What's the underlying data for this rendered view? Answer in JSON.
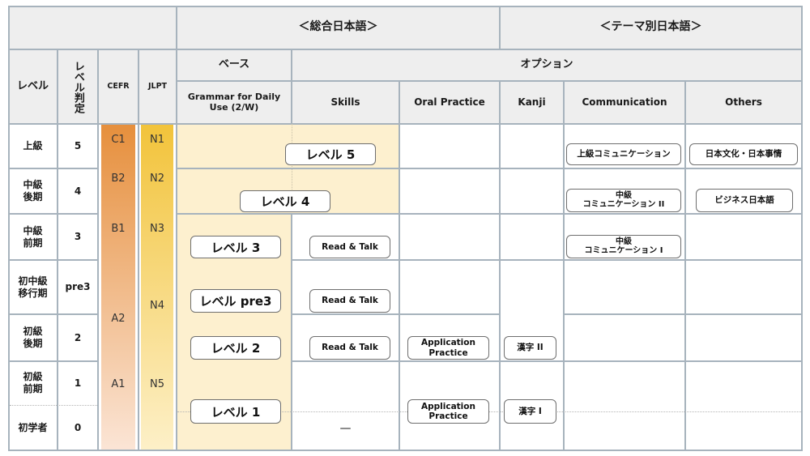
{
  "header": {
    "group_general": "＜総合日本語＞",
    "group_theme": "＜テーマ別日本語＞",
    "col_level": "レベル",
    "col_level_judge": "レベル判定",
    "col_cefr": "CEFR",
    "col_jlpt": "JLPT",
    "base": "ベース",
    "option": "オプション",
    "col_grammar": "Grammar for Daily Use (2/W)",
    "col_skills": "Skills",
    "col_oral": "Oral Practice",
    "col_kanji": "Kanji",
    "col_communication": "Communication",
    "col_others": "Others"
  },
  "rows": [
    {
      "level": "上級",
      "judge": "5"
    },
    {
      "level": "中級\n後期",
      "judge": "4"
    },
    {
      "level": "中級\n前期",
      "judge": "3"
    },
    {
      "level": "初中級\n移行期",
      "judge": "pre3"
    },
    {
      "level": "初級\n後期",
      "judge": "2"
    },
    {
      "level": "初級\n前期",
      "judge": "1"
    },
    {
      "level": "初学者",
      "judge": "0"
    }
  ],
  "cefr": [
    "C1",
    "B2",
    "B1",
    "A2",
    "A1"
  ],
  "jlpt": [
    "N1",
    "N2",
    "N3",
    "N4",
    "N5"
  ],
  "colors": {
    "cefr_top": "#e68f3c",
    "cefr_bottom": "#fbe5d6",
    "jlpt_top": "#f2c33a",
    "jlpt_bottom": "#fdf0c8",
    "base_bg": "#fdf0cf",
    "header_bg": "#eeeeee",
    "grid": "#a7b3bd"
  },
  "courses": {
    "grammar": [
      "レベル 5",
      "レベル 4",
      "レベル 3",
      "レベル pre3",
      "レベル 2",
      "レベル 1"
    ],
    "skills": [
      "Read & Talk",
      "Read & Talk",
      "Read & Talk"
    ],
    "skills_none": "—",
    "oral": [
      "Application Practice",
      "Application Practice"
    ],
    "kanji": [
      "漢字 II",
      "漢字 I"
    ],
    "communication": [
      "上級コミュニケーション",
      "中級\nコミュニケーション II",
      "中級\nコミュニケーション I"
    ],
    "others": [
      "日本文化・日本事情",
      "ビジネス日本語"
    ]
  }
}
